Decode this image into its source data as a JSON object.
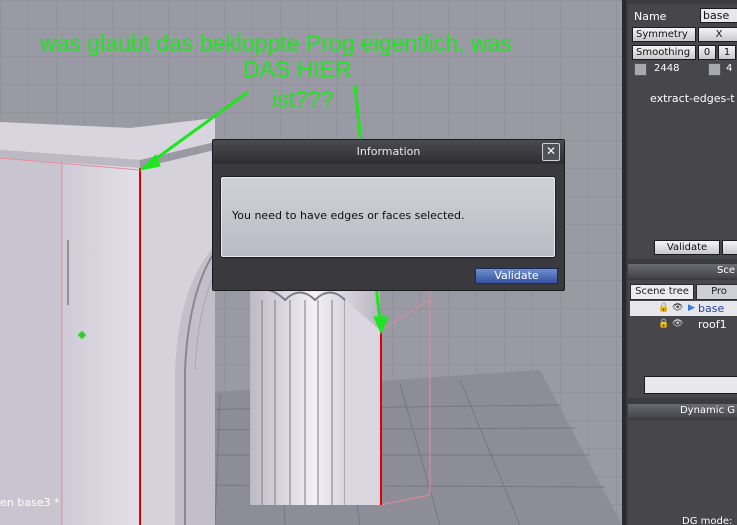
{
  "viewport": {
    "scene_label": "en base3 *"
  },
  "annotation": {
    "line1": "was glaubt das bekloppte Prog eigentlich, was",
    "line2": "DAS HIER",
    "line3": "ist???",
    "color": "#1ee61e"
  },
  "dialog": {
    "title": "Information",
    "close_glyph": "✕",
    "message": "You need to have edges or faces selected.",
    "validate_label": "Validate"
  },
  "properties": {
    "name_label": "Name",
    "name_value": "base",
    "symmetry_label": "Symmetry",
    "symmetry_value": "X",
    "smoothing_label": "Smoothing",
    "smoothing_value_a": "0",
    "smoothing_value_b": "1",
    "count_a": "2448",
    "count_b": "4",
    "extract_label": "extract-edges-t",
    "validate_label": "Validate"
  },
  "scene": {
    "header": "Sce",
    "tab_scene_tree": "Scene tree",
    "tab_pro": "Pro",
    "items": [
      {
        "label": "base"
      },
      {
        "label": "roof1"
      }
    ]
  },
  "dynamic": {
    "header": "Dynamic G",
    "mode_label": "DG mode:"
  },
  "colors": {
    "accent": "#3552a0",
    "selection": "#e00000",
    "annotation": "#1ee61e"
  }
}
